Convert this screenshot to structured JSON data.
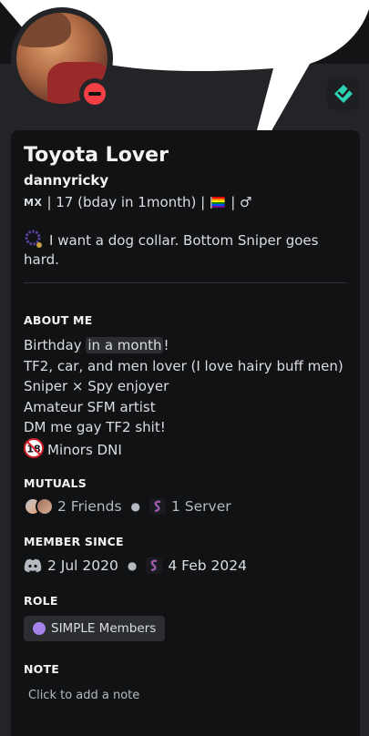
{
  "profile": {
    "display_name": "Toyota Lover",
    "username": "dannyricky",
    "pronouns_prefix": "MX",
    "pronouns_text": "| 17 (bday in 1month) |",
    "pronouns_suffix": "| ♂",
    "custom_status": "I want a dog collar. Bottom Sniper goes hard.",
    "status": "do-not-disturb",
    "status_color": "#f23f43"
  },
  "about": {
    "heading": "ABOUT ME",
    "line1_prefix": "Birthday ",
    "line1_timestamp": "in a month",
    "line1_suffix": "!",
    "line2": "TF2, car, and men lover (I love hairy buff men)",
    "line3": "Sniper × Spy enjoyer",
    "line4": "Amateur SFM artist",
    "line5": "DM me gay TF2 shit!",
    "line6": "Minors DNI"
  },
  "mutuals": {
    "heading": "MUTUALS",
    "friends": "2 Friends",
    "servers": "1 Server"
  },
  "member_since": {
    "heading": "MEMBER SINCE",
    "discord_date": "2 Jul 2020",
    "server_date": "4 Feb 2024"
  },
  "role": {
    "heading": "ROLE",
    "name": "SIMPLE Members",
    "color": "#a683e8"
  },
  "note": {
    "heading": "NOTE",
    "placeholder": "Click to add a note"
  },
  "icons": {
    "status_icon": "prayer-beads-icon",
    "dni_icon": "18-prohibited-icon",
    "discord_icon": "discord-logo-icon",
    "server_icon": "server-s-icon",
    "badge_icon": "diamond-badge-icon"
  },
  "colors": {
    "accent_teal": "#2dd4b4",
    "card_bg": "#111214",
    "page_bg": "#232428"
  }
}
